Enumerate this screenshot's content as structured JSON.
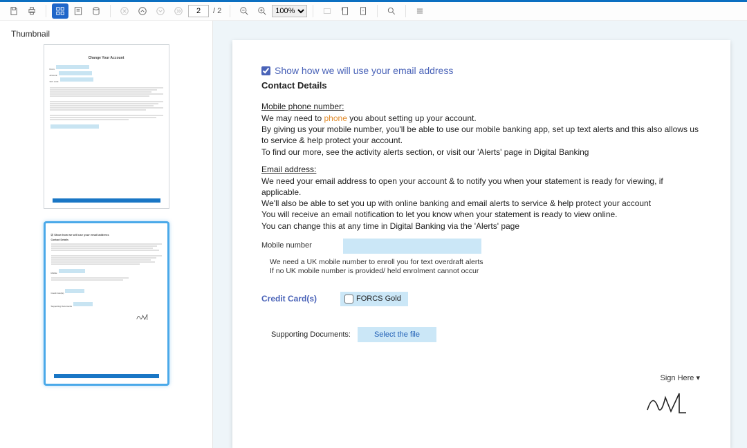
{
  "toolbar": {
    "page_current": "2",
    "page_total": "2",
    "zoom": "100%"
  },
  "sidebar": {
    "title": "Thumbnail",
    "thumb1_title": "Change Your Account"
  },
  "doc": {
    "show_label": "Show how we will use your email address",
    "contact_hdr": "Contact Details",
    "mobile_hdr": "Mobile phone number:",
    "mobile_p1a": "We may need to ",
    "mobile_p1b": "phone",
    "mobile_p1c": " you about setting up your account.",
    "mobile_p2": "By giving us your mobile number, you'll be able to use our mobile banking app, set up text alerts and this also allows us to service & help protect your account.",
    "mobile_p3": "To find our more, see the activity alerts section, or visit our 'Alerts' page in Digital Banking",
    "email_hdr": "Email address:",
    "email_p1": "We need your email address to open your account & to notify you when your statement is ready for viewing, if applicable.",
    "email_p2": "We'll also be able to set you up with online banking and email alerts to service & help protect your account",
    "email_p3": "You will receive an email notification to let you know when your statement is ready to view online.",
    "email_p4": "You can change this at any time in Digital Banking via the 'Alerts' page",
    "mobile_field_label": "Mobile number",
    "mobile_note1": "We need a UK mobile number to enroll you for text overdraft alerts",
    "mobile_note2": "If no UK mobile number is provided/ held enrolment cannot occur",
    "cc_label": "Credit Card(s)",
    "cc_option": "FORCS Gold",
    "support_label": "Supporting Documents:",
    "select_file": "Select the file",
    "sign_here": "Sign Here ▾"
  }
}
